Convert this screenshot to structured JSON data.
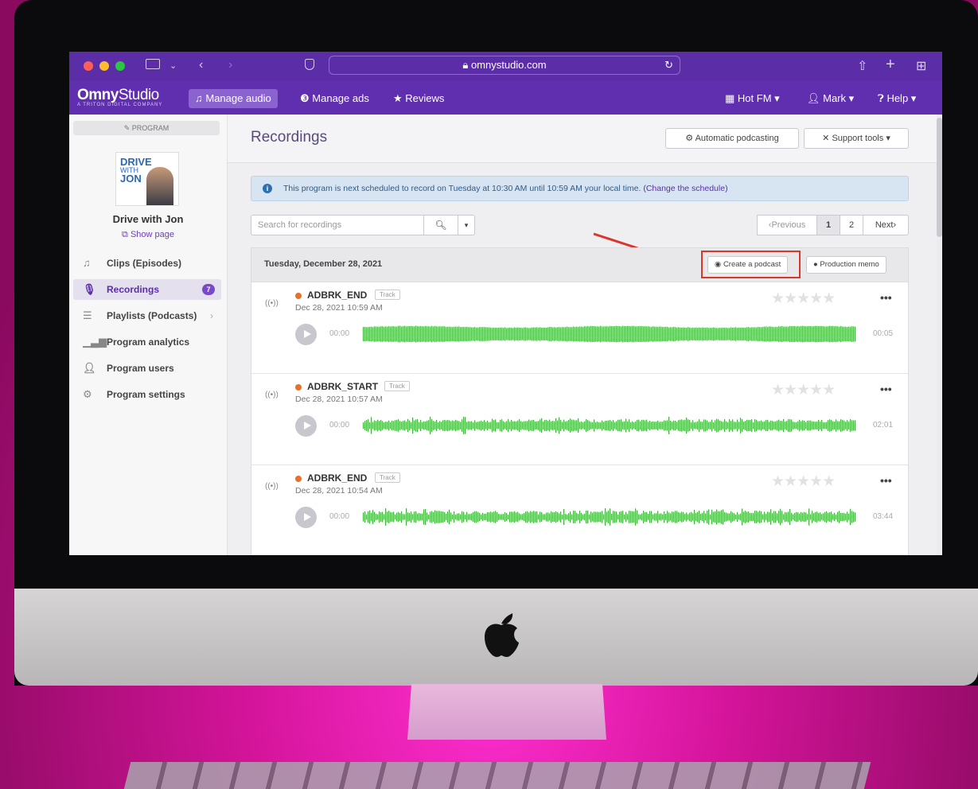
{
  "browser": {
    "url": "omnystudio.com"
  },
  "brand": {
    "logo_main": "Omny",
    "logo_light": "Studio",
    "logo_sub": "A TRITON DIGITAL COMPANY"
  },
  "nav": {
    "manage_audio": "Manage audio",
    "manage_ads": "Manage ads",
    "reviews": "Reviews",
    "org": "Hot FM",
    "user": "Mark",
    "help": "Help"
  },
  "sidebar": {
    "program_label": "PROGRAM",
    "cover_line1": "DRIVE",
    "cover_line2": "WITH",
    "cover_line3": "JON",
    "program_name": "Drive with Jon",
    "show_page": "Show page",
    "items": [
      {
        "label": "Clips (Episodes)",
        "icon": "music-note-icon"
      },
      {
        "label": "Recordings",
        "icon": "microphone-icon",
        "badge": "7"
      },
      {
        "label": "Playlists (Podcasts)",
        "icon": "list-icon"
      },
      {
        "label": "Program analytics",
        "icon": "bar-chart-icon"
      },
      {
        "label": "Program users",
        "icon": "user-icon"
      },
      {
        "label": "Program settings",
        "icon": "gear-icon"
      }
    ]
  },
  "main": {
    "title": "Recordings",
    "auto_podcasting": "Automatic podcasting",
    "support_tools": "Support tools",
    "info_text": "This program is next scheduled to record on Tuesday at 10:30 AM until 10:59 AM your local time.",
    "info_link": "(Change the schedule)",
    "search_placeholder": "Search for recordings",
    "pager": {
      "previous": "Previous",
      "page1": "1",
      "page2": "2",
      "next": "Next"
    },
    "list_date": "Tuesday, December 28, 2021",
    "create_podcast": "Create a podcast",
    "production_memo": "Production memo",
    "recordings": [
      {
        "name": "ADBRK_END",
        "tag": "Track",
        "date": "Dec 28, 2021 10:59 AM",
        "start": "00:00",
        "end": "00:05"
      },
      {
        "name": "ADBRK_START",
        "tag": "Track",
        "date": "Dec 28, 2021 10:57 AM",
        "start": "00:00",
        "end": "02:01"
      },
      {
        "name": "ADBRK_END",
        "tag": "Track",
        "date": "Dec 28, 2021 10:54 AM",
        "start": "00:00",
        "end": "03:44"
      }
    ]
  },
  "colors": {
    "brand_purple": "#5f2fb0",
    "waveform_green": "#3fae3a",
    "highlight_red": "#d9352a",
    "status_orange": "#e8702a"
  }
}
